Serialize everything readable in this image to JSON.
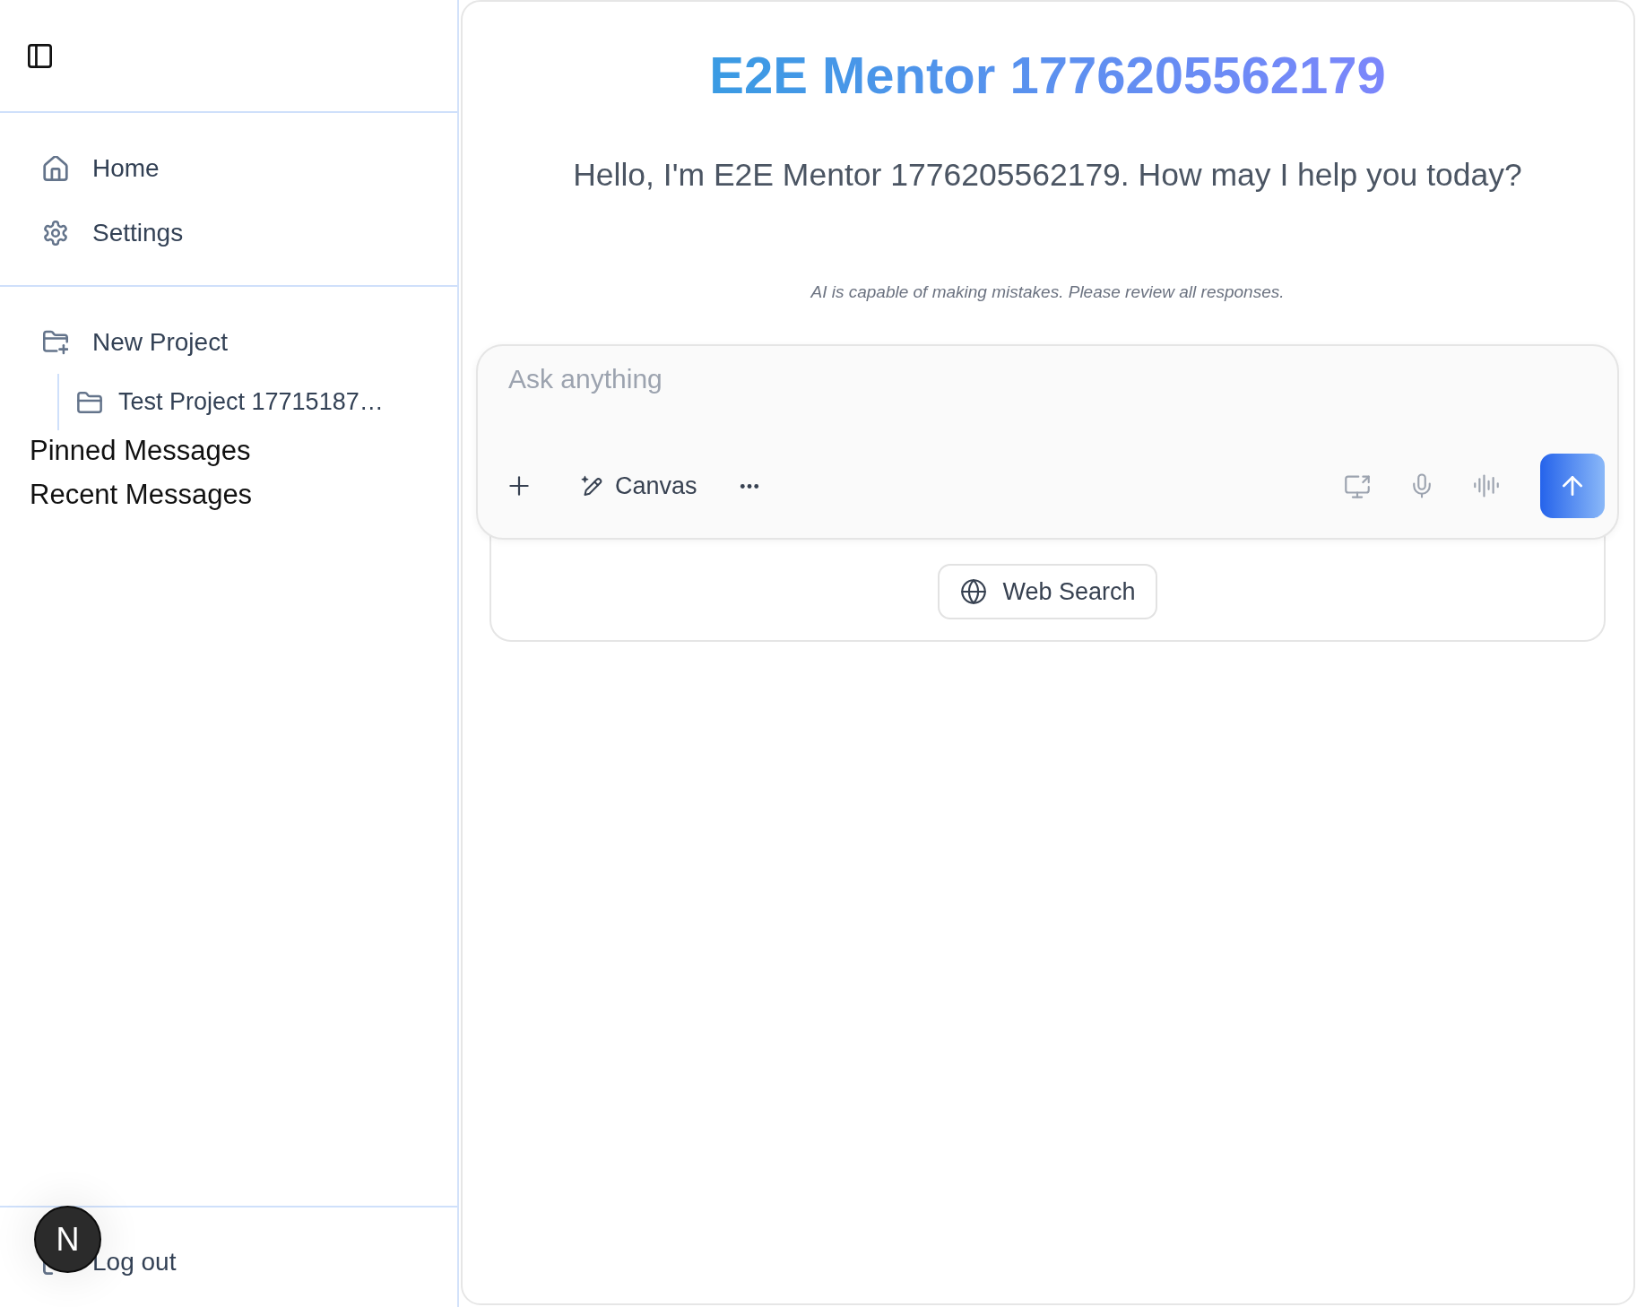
{
  "sidebar": {
    "nav": [
      {
        "label": "Home",
        "kind": "home"
      },
      {
        "label": "Settings",
        "kind": "settings"
      }
    ],
    "projects": [
      {
        "label": "New Project",
        "children": [
          {
            "label": "Test Project 17715187…"
          }
        ]
      }
    ],
    "sections": [
      {
        "label": "Pinned Messages"
      },
      {
        "label": "Recent Messages"
      }
    ],
    "footer": {
      "label": "Log out"
    }
  },
  "dev_indicator": {
    "label": "N"
  },
  "main": {
    "title": "E2E Mentor 1776205562179",
    "greeting": "Hello, I'm E2E Mentor 1776205562179. How may I help you today?",
    "disclaimer": "AI is capable of making mistakes. Please review all responses.",
    "composer": {
      "placeholder": "Ask anything",
      "canvas_button": {
        "label": "Canvas"
      }
    },
    "web_search": {
      "label": "Web Search"
    }
  }
}
